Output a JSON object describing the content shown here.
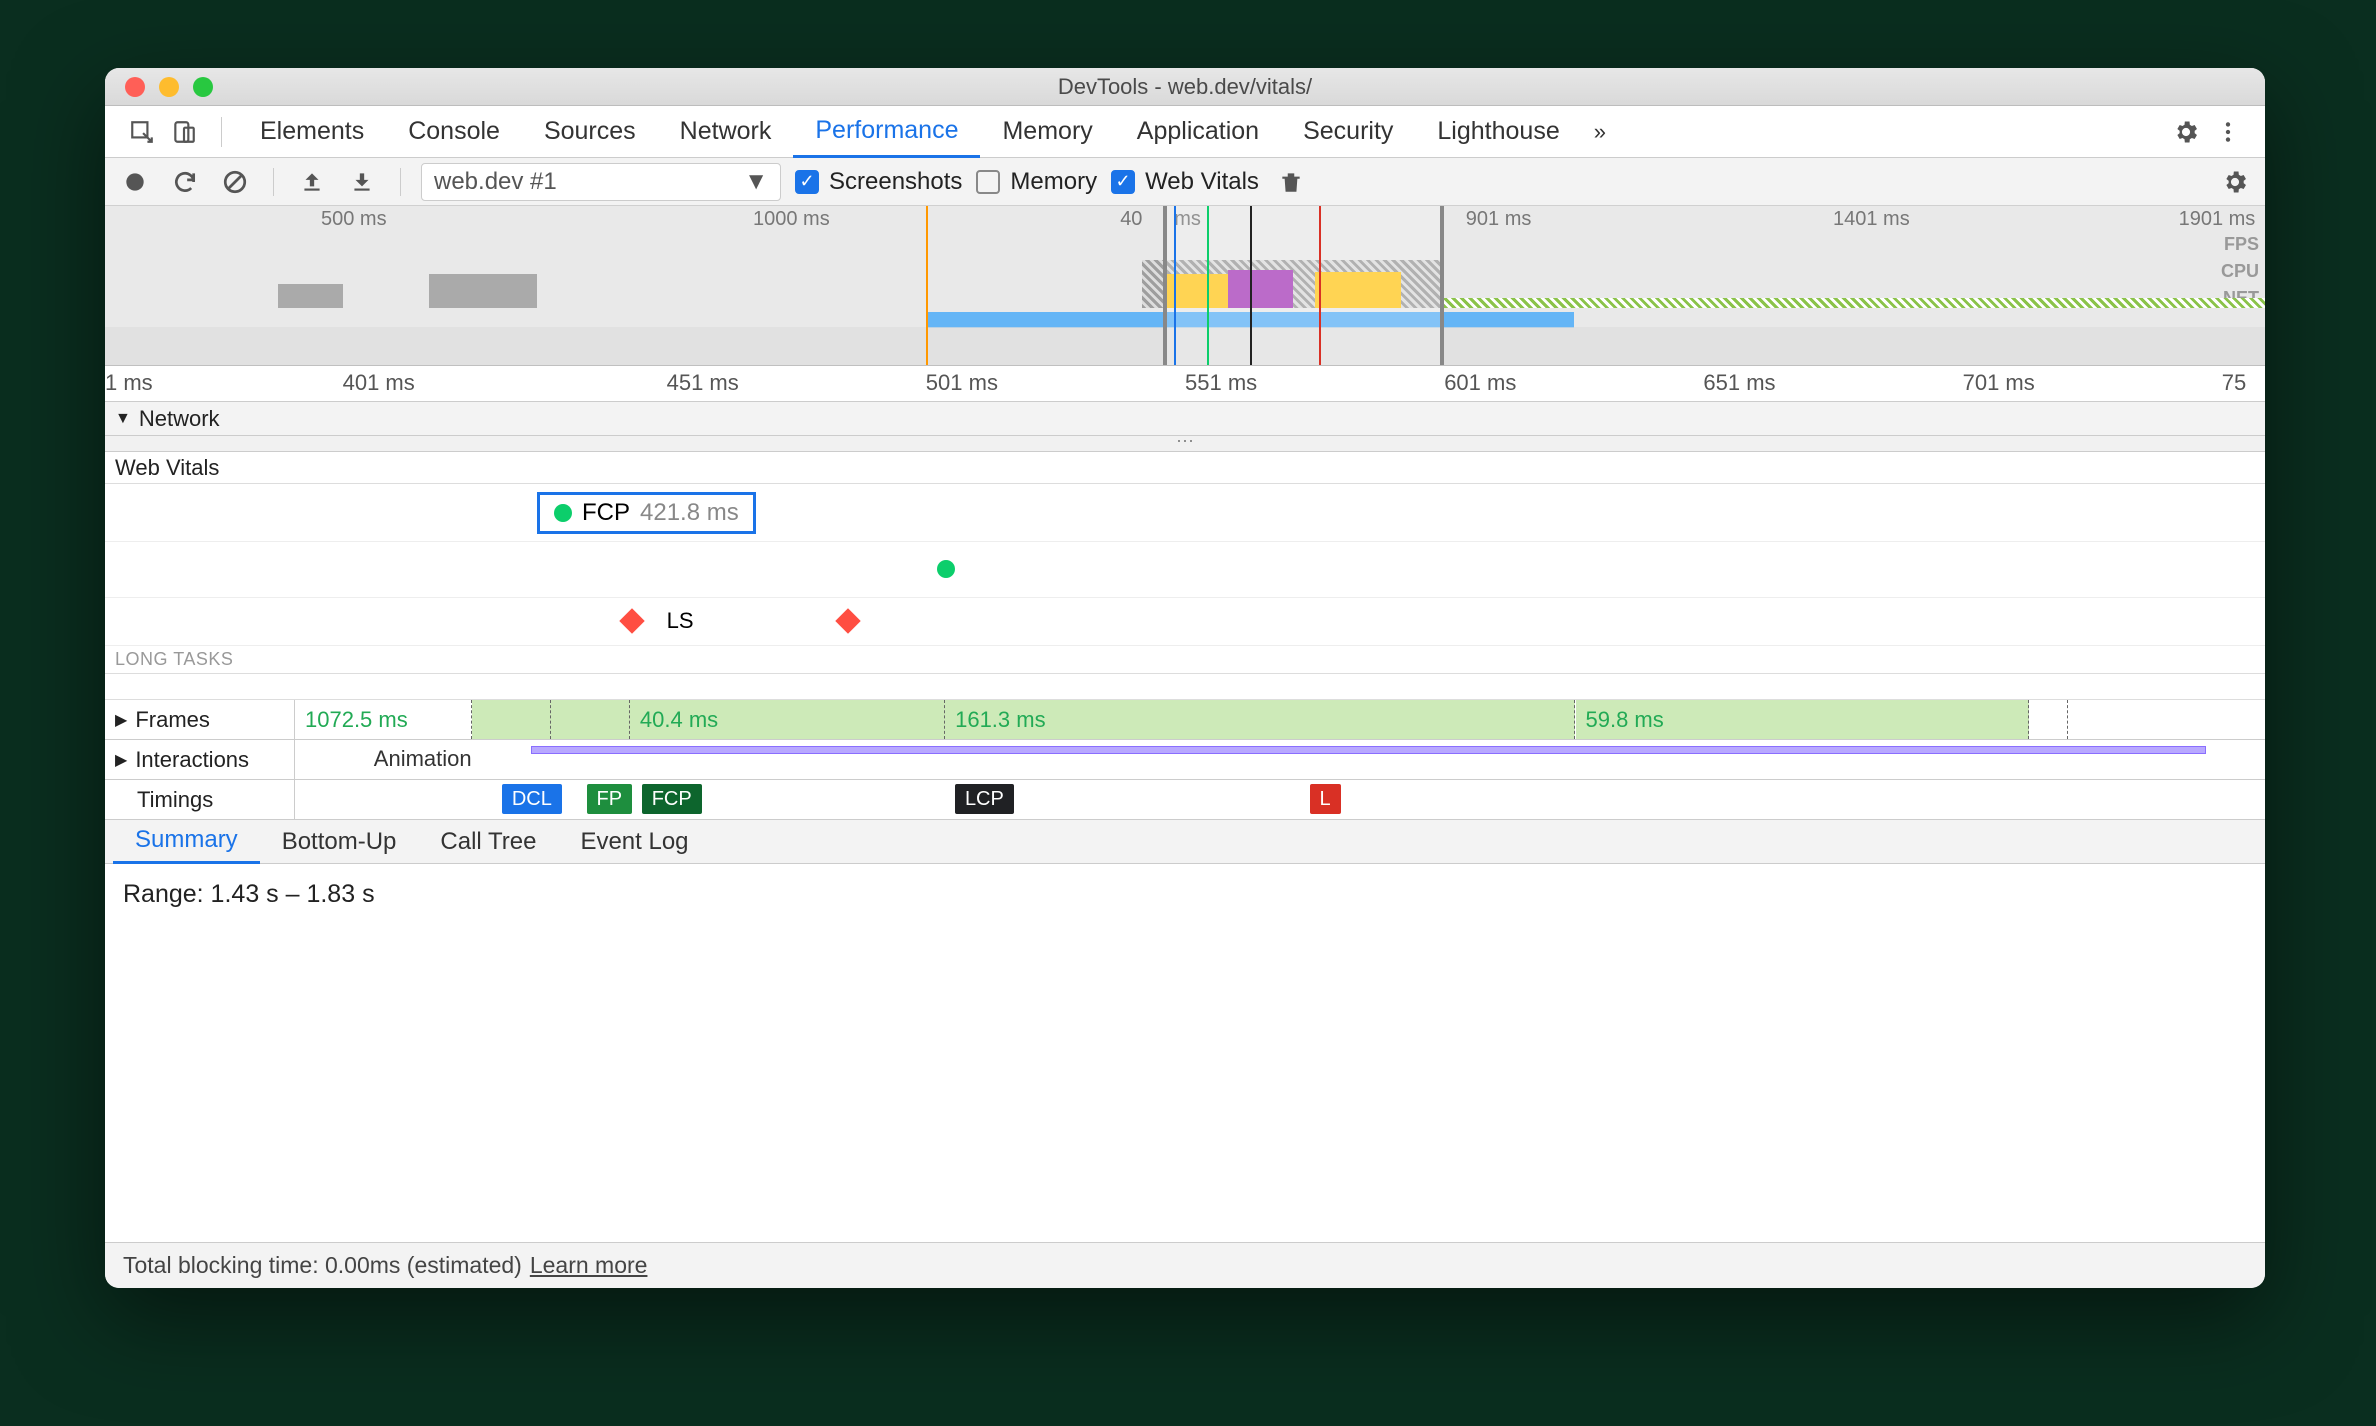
{
  "window": {
    "title": "DevTools - web.dev/vitals/"
  },
  "tabs": {
    "items": [
      "Elements",
      "Console",
      "Sources",
      "Network",
      "Performance",
      "Memory",
      "Application",
      "Security",
      "Lighthouse"
    ],
    "active": "Performance",
    "more": "»"
  },
  "controls": {
    "profile_dropdown": "web.dev #1",
    "screenshots": {
      "label": "Screenshots",
      "checked": true
    },
    "memory": {
      "label": "Memory",
      "checked": false
    },
    "web_vitals": {
      "label": "Web Vitals",
      "checked": true
    }
  },
  "overview": {
    "ticks": [
      {
        "label": "500 ms",
        "pct": 10
      },
      {
        "label": "1000 ms",
        "pct": 30
      },
      {
        "label": "40",
        "pct": 47
      },
      {
        "label": "ms",
        "pct": 49.5
      },
      {
        "label": "901 ms",
        "pct": 63
      },
      {
        "label": "1401 ms",
        "pct": 80
      },
      {
        "label": "1901 ms",
        "pct": 96
      }
    ],
    "labels": [
      "FPS",
      "CPU",
      "NET"
    ],
    "selection": {
      "left_pct": 49,
      "right_pct": 62
    },
    "markers": [
      {
        "pct": 49.5,
        "color": "#1a73e8"
      },
      {
        "pct": 51.0,
        "color": "#0cce6b"
      },
      {
        "pct": 53.0,
        "color": "#222"
      },
      {
        "pct": 56.2,
        "color": "#d93025"
      },
      {
        "pct": 38.0,
        "color": "#ff9800"
      }
    ]
  },
  "ruler": {
    "ticks": [
      {
        "label": "1 ms",
        "pct": 0
      },
      {
        "label": "401 ms",
        "pct": 11
      },
      {
        "label": "451 ms",
        "pct": 26
      },
      {
        "label": "501 ms",
        "pct": 38
      },
      {
        "label": "551 ms",
        "pct": 50
      },
      {
        "label": "601 ms",
        "pct": 62
      },
      {
        "label": "651 ms",
        "pct": 74
      },
      {
        "label": "701 ms",
        "pct": 86
      },
      {
        "label": "75",
        "pct": 98
      }
    ]
  },
  "network_section": {
    "label": "Network"
  },
  "web_vitals": {
    "header": "Web Vitals",
    "fcp": {
      "name": "FCP",
      "value": "421.8 ms",
      "left_pct": 20
    },
    "green_marker_pct": 38.5,
    "ls": {
      "label": "LS",
      "markers_pct": [
        24,
        34
      ]
    },
    "long_tasks_label": "LONG TASKS"
  },
  "frames": {
    "label": "Frames",
    "segments": [
      {
        "label": "1072.5 ms",
        "left_pct": 0,
        "width_pct": 9,
        "bg": "#fff"
      },
      {
        "label": "",
        "left_pct": 9,
        "width_pct": 4
      },
      {
        "label": "",
        "left_pct": 13,
        "width_pct": 4
      },
      {
        "label": "40.4 ms",
        "left_pct": 17,
        "width_pct": 16
      },
      {
        "label": "161.3 ms",
        "left_pct": 33,
        "width_pct": 32
      },
      {
        "label": "59.8 ms",
        "left_pct": 65,
        "width_pct": 23
      },
      {
        "label": "",
        "left_pct": 88,
        "width_pct": 2,
        "bg": "#fff"
      }
    ]
  },
  "interactions": {
    "label": "Interactions",
    "animation_label": "Animation",
    "bar_left_pct": 12,
    "bar_width_pct": 85
  },
  "timings": {
    "label": "Timings",
    "badges": [
      {
        "text": "DCL",
        "color": "#1a73e8",
        "left_pct": 10.5
      },
      {
        "text": "FP",
        "color": "#1e8e3e",
        "left_pct": 14.8
      },
      {
        "text": "FCP",
        "color": "#0d652d",
        "left_pct": 17.6
      },
      {
        "text": "LCP",
        "color": "#202124",
        "left_pct": 33.5
      },
      {
        "text": "L",
        "color": "#d93025",
        "left_pct": 51.5
      }
    ]
  },
  "details": {
    "tabs": [
      "Summary",
      "Bottom-Up",
      "Call Tree",
      "Event Log"
    ],
    "active": "Summary",
    "range": "Range: 1.43 s – 1.83 s"
  },
  "footer": {
    "tbt": "Total blocking time: 0.00ms (estimated)",
    "learn_more": "Learn more"
  },
  "icons": {
    "gear": "gear-icon",
    "more_v": "more-vertical-icon"
  }
}
